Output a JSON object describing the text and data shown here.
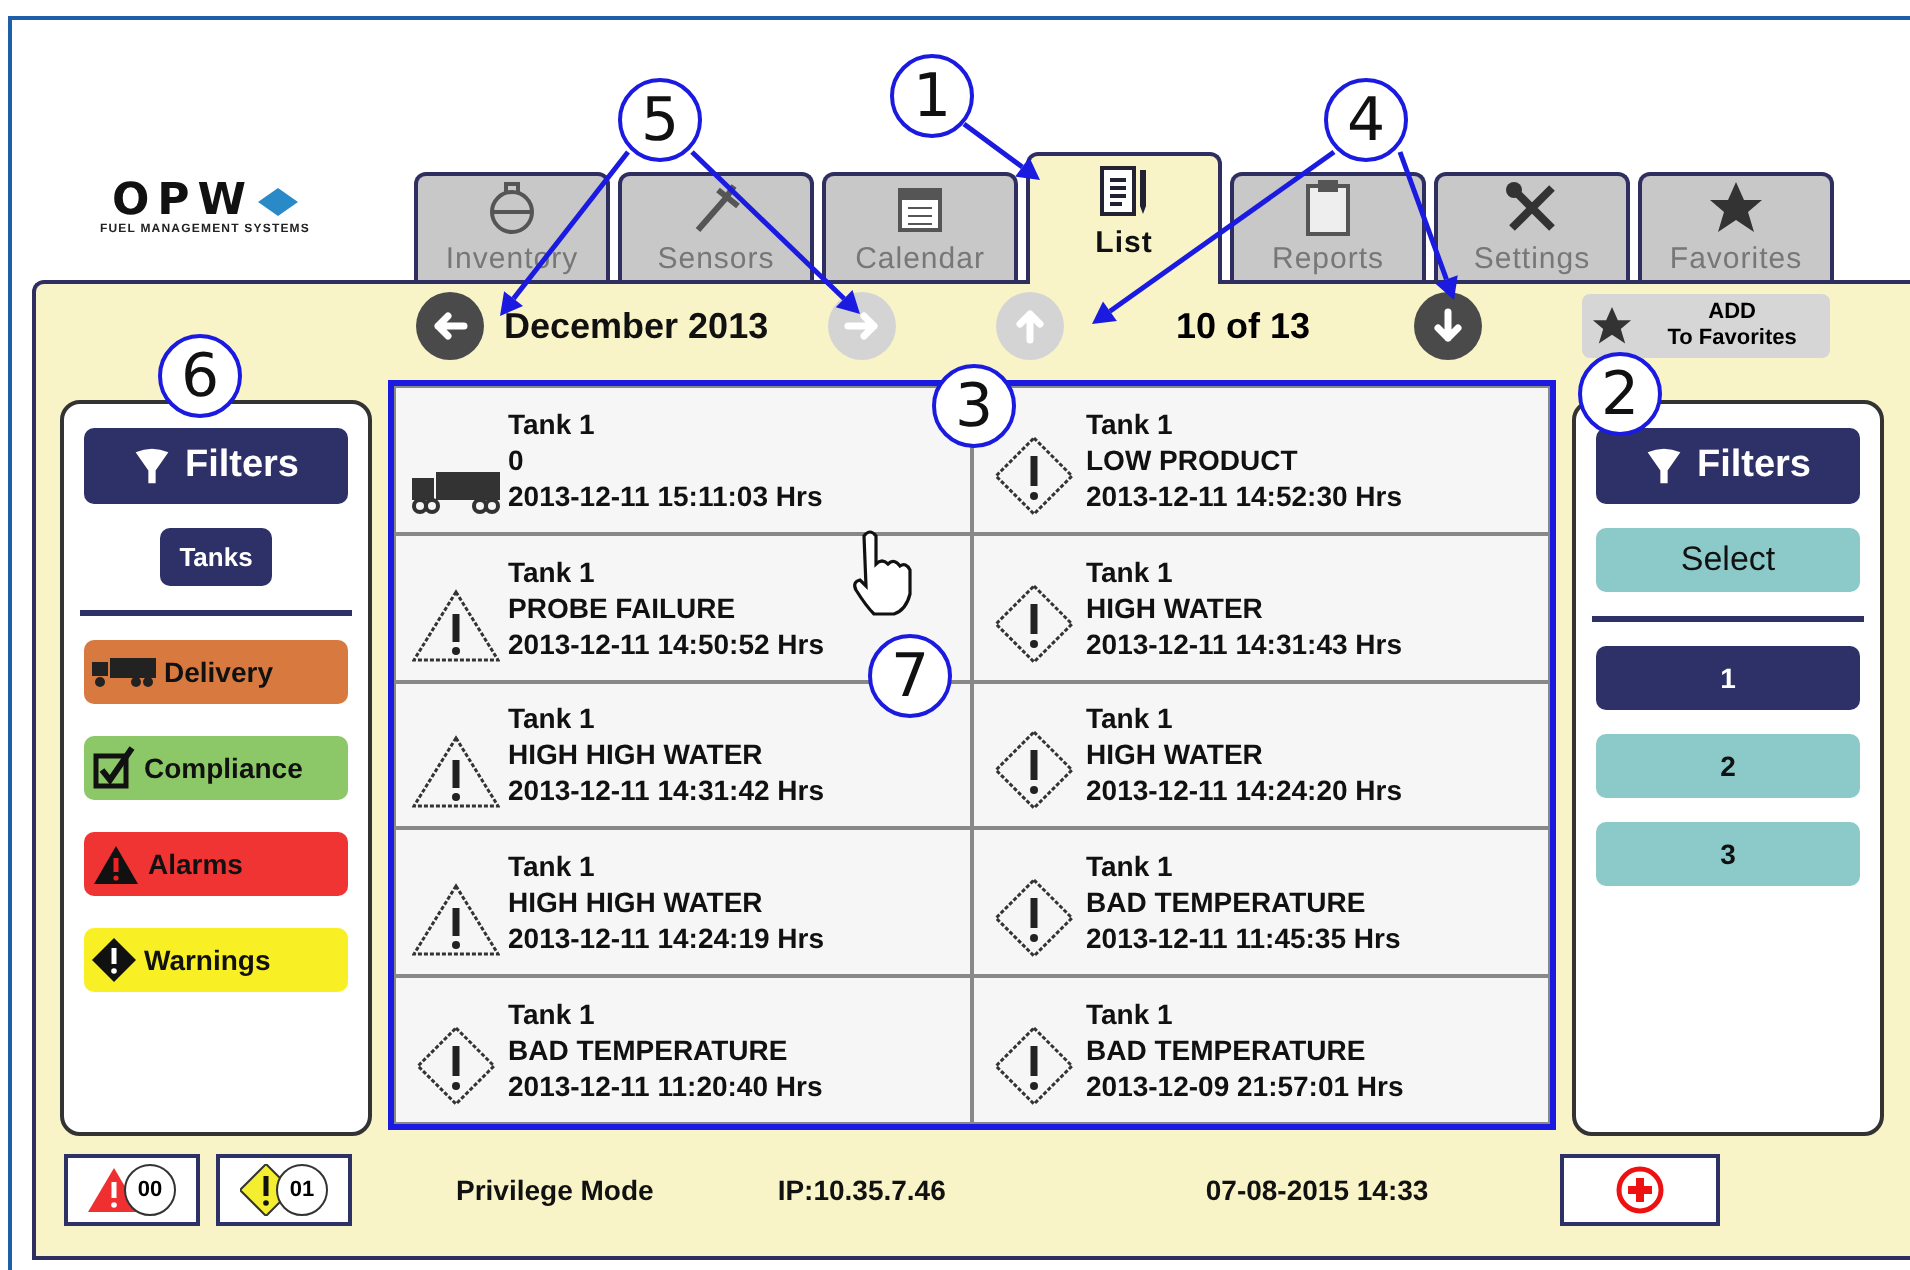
{
  "logo": {
    "name": "OPW",
    "tagline": "FUEL MANAGEMENT SYSTEMS"
  },
  "tabs": [
    {
      "label": "Inventory",
      "selected": false
    },
    {
      "label": "Sensors",
      "selected": false
    },
    {
      "label": "Calendar",
      "selected": false
    },
    {
      "label": "List",
      "selected": true
    },
    {
      "label": "Reports",
      "selected": false
    },
    {
      "label": "Settings",
      "selected": false
    },
    {
      "label": "Favorites",
      "selected": false
    }
  ],
  "nav": {
    "previous": {
      "disabled": false
    },
    "month": "December 2013",
    "next": {
      "disabled": true
    },
    "up": {
      "disabled": true
    },
    "position": "10 of 13",
    "down": {
      "disabled": false
    },
    "add_favorites": "ADD\nTo Favorites"
  },
  "left_panel": {
    "filters": "Filters",
    "tanks": "Tanks",
    "categories": [
      {
        "label": "Delivery",
        "kind": "delivery",
        "color": "#d87a40"
      },
      {
        "label": "Compliance",
        "kind": "compliance",
        "color": "#8cc868"
      },
      {
        "label": "Alarms",
        "kind": "alarm",
        "color": "#f03434"
      },
      {
        "label": "Warnings",
        "kind": "warning",
        "color": "#f8f024"
      }
    ]
  },
  "events": [
    {
      "kind": "delivery",
      "tank": "Tank 1",
      "event": "0",
      "time": "2013-12-11 15:11:03 Hrs"
    },
    {
      "kind": "warning",
      "tank": "Tank 1",
      "event": "LOW PRODUCT",
      "time": "2013-12-11 14:52:30 Hrs"
    },
    {
      "kind": "alarm",
      "tank": "Tank 1",
      "event": "PROBE FAILURE",
      "time": "2013-12-11 14:50:52 Hrs"
    },
    {
      "kind": "warning",
      "tank": "Tank 1",
      "event": "HIGH WATER",
      "time": "2013-12-11 14:31:43 Hrs"
    },
    {
      "kind": "alarm",
      "tank": "Tank 1",
      "event": "HIGH HIGH WATER",
      "time": "2013-12-11 14:31:42 Hrs"
    },
    {
      "kind": "warning",
      "tank": "Tank 1",
      "event": "HIGH WATER",
      "time": "2013-12-11 14:24:20 Hrs"
    },
    {
      "kind": "alarm",
      "tank": "Tank 1",
      "event": "HIGH HIGH WATER",
      "time": "2013-12-11 14:24:19 Hrs"
    },
    {
      "kind": "warning",
      "tank": "Tank 1",
      "event": "BAD TEMPERATURE",
      "time": "2013-12-11 11:45:35 Hrs"
    },
    {
      "kind": "warning",
      "tank": "Tank 1",
      "event": "BAD TEMPERATURE",
      "time": "2013-12-11 11:20:40 Hrs"
    },
    {
      "kind": "warning",
      "tank": "Tank 1",
      "event": "BAD TEMPERATURE",
      "time": "2013-12-09 21:57:01 Hrs"
    }
  ],
  "right_panel": {
    "filters": "Filters",
    "select": "Select",
    "items": [
      {
        "label": "1",
        "selected": true
      },
      {
        "label": "2",
        "selected": false
      },
      {
        "label": "3",
        "selected": false
      }
    ]
  },
  "counters": [
    {
      "kind": "alarm",
      "count": "00"
    },
    {
      "kind": "warning",
      "count": "01"
    }
  ],
  "status_bar": {
    "mode": "Privilege Mode",
    "ip": "IP:10.35.7.46",
    "datetime": "07-08-2015 14:33"
  },
  "callouts": [
    "1",
    "5",
    "4",
    "6",
    "3",
    "2",
    "7"
  ]
}
